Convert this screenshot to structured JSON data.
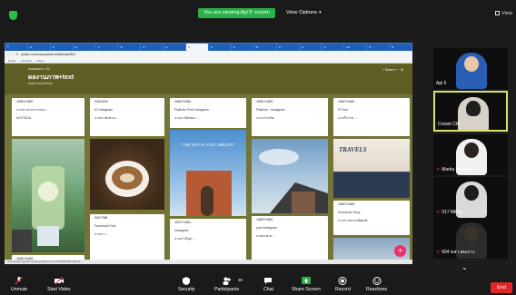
{
  "topbar": {
    "viewing_text": "You are viewing Api 5' screen",
    "view_options": "View Options",
    "view_mode": "View"
  },
  "browser": {
    "tabs": [
      "ใ",
      "ฝ",
      "ฝ",
      "ฝ",
      "ก",
      "ห",
      "ส",
      "ห",
      "1",
      "ป",
      "ผ",
      "ห",
      "ห",
      "น",
      "ห",
      "เพ",
      "ห",
      "ห"
    ],
    "url": "padlet.com/ananyaandhmia/jhdhqsi3fk9",
    "bookmarks": [
      "Gmail",
      "YouTube",
      "Maps"
    ],
    "status_url": "https://padlet-uploads.storage.googleapis.com/1445296408/41c3b1e5..."
  },
  "padlet": {
    "owner": "ananyaann • 3h",
    "title": "ผลงานภาพ+text",
    "subtitle": "Made with Artistry",
    "tools": "+ Share ▾ ⋯ ⚙"
  },
  "cards": [
    {
      "size": "1080*1080",
      "l2": "นางสาวอรอรวรรณนา",
      "l3": "624701111"
    },
    {
      "size": "325x325",
      "l2": "IG Instagram",
      "l3": "นางสาวฝั่งทะเล ..."
    },
    {
      "size": "1080*1080",
      "l2": "Platform Post Instagram",
      "l3": "นางสาวปิยชนก ..."
    },
    {
      "size": "1080*1080",
      "l2": "Platform : Instagram",
      "l3": "นาย ดำรงชัย"
    },
    {
      "size": "1080*1080",
      "l2": "FF 6no",
      "l3": "นายวีรภาพ ..."
    },
    {
      "size": "940*788",
      "l2": "Facebook Post",
      "l3": "นางสาว ..."
    },
    {
      "size": "1921*1081",
      "l2": "Instagram",
      "l3": "นางสาวนิมูล ..."
    },
    {
      "size": "1080*1080",
      "l2": "post Instagram",
      "l3": "นายสมชาย ..."
    },
    {
      "size": "1080*1080",
      "l2": "Facebook Story",
      "l3": "นางสาวพรรณพัทพงศ์"
    },
    {
      "size": "1080*1080",
      "l2": "",
      "l3": ""
    }
  ],
  "photo_texts": {
    "sky": "\" THE SKY IS STILL BRIGHT \"",
    "travel": "TRAVELS"
  },
  "participants": [
    {
      "name": "Api 5",
      "muted": false
    },
    {
      "name": "Cream Clin",
      "muted": false
    },
    {
      "name": "Martia Supharat",
      "muted": true
    },
    {
      "name": "017 Milkky",
      "muted": true
    },
    {
      "name": "604 ทสา.สมเกาะ",
      "muted": true
    }
  ],
  "toolbar": {
    "unmute": "Unmute",
    "start_video": "Start Video",
    "security": "Security",
    "participants": "Participants",
    "participant_count": "30",
    "chat": "Chat",
    "share_screen": "Share Screen",
    "record": "Record",
    "reactions": "Reactions",
    "end": "End"
  },
  "colors": {
    "green": "#2bb04a",
    "end_red": "#e02828",
    "active_border": "#d9e26a",
    "padlet_bg": "#747436"
  }
}
